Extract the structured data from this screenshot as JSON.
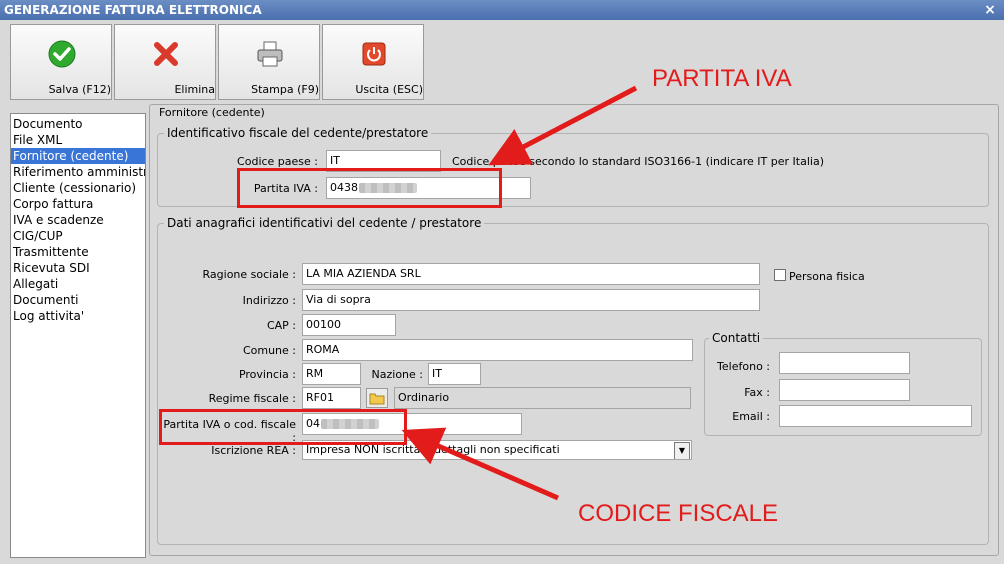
{
  "window": {
    "title": "GENERAZIONE FATTURA ELETTRONICA",
    "close_glyph": "×"
  },
  "toolbar": {
    "save": {
      "label": "Salva (F12)",
      "icon": "check-icon"
    },
    "delete": {
      "label": "Elimina",
      "icon": "delete-x-icon"
    },
    "print": {
      "label": "Stampa (F9)",
      "icon": "printer-icon"
    },
    "exit": {
      "label": "Uscita (ESC)",
      "icon": "power-icon"
    }
  },
  "nav": {
    "items": [
      {
        "label": "Documento",
        "selected": false
      },
      {
        "label": "File XML",
        "selected": false
      },
      {
        "label": "Fornitore (cedente)",
        "selected": true
      },
      {
        "label": "Riferimento amministrativo",
        "selected": false
      },
      {
        "label": "Cliente (cessionario)",
        "selected": false
      },
      {
        "label": "Corpo fattura",
        "selected": false
      },
      {
        "label": "IVA e scadenze",
        "selected": false
      },
      {
        "label": "CIG/CUP",
        "selected": false
      },
      {
        "label": "Trasmittente",
        "selected": false
      },
      {
        "label": "Ricevuta SDI",
        "selected": false
      },
      {
        "label": "Allegati",
        "selected": false
      },
      {
        "label": "Documenti",
        "selected": false
      },
      {
        "label": "Log attivita'",
        "selected": false
      }
    ]
  },
  "main": {
    "panel_title": "Fornitore (cedente)",
    "fiscal_group": {
      "title": "Identificativo fiscale del cedente/prestatore",
      "country_code_label": "Codice paese :",
      "country_code_value": "IT",
      "country_code_hint": "Codice paese secondo lo standard ISO3166-1 (indicare IT per Italia)",
      "vat_label": "Partita IVA :",
      "vat_value": "0438"
    },
    "registry_group": {
      "title": "Dati anagrafici identificativi del cedente / prestatore",
      "company_label": "Ragione sociale :",
      "company_value": "LA MIA AZIENDA SRL",
      "natural_person_label": "Persona fisica",
      "address_label": "Indirizzo :",
      "address_value": "Via di sopra",
      "zip_label": "CAP :",
      "zip_value": "00100",
      "city_label": "Comune :",
      "city_value": "ROMA",
      "province_label": "Provincia :",
      "province_value": "RM",
      "nation_label": "Nazione :",
      "nation_value": "IT",
      "tax_regime_label": "Regime fiscale :",
      "tax_regime_code": "RF01",
      "tax_regime_desc": "Ordinario",
      "vat_or_tax_code_label": "Partita IVA o cod. fiscale :",
      "vat_or_tax_code_value": "04",
      "rea_label": "Iscrizione REA :",
      "rea_value": "Impresa NON iscritta o dettagli non specificati"
    },
    "contacts": {
      "title": "Contatti",
      "phone_label": "Telefono :",
      "phone_value": "",
      "fax_label": "Fax :",
      "fax_value": "",
      "email_label": "Email :",
      "email_value": ""
    }
  },
  "annotations": {
    "vat_callout": "PARTITA IVA",
    "tax_code_callout": "CODICE FISCALE",
    "color": "#e21b1b"
  }
}
